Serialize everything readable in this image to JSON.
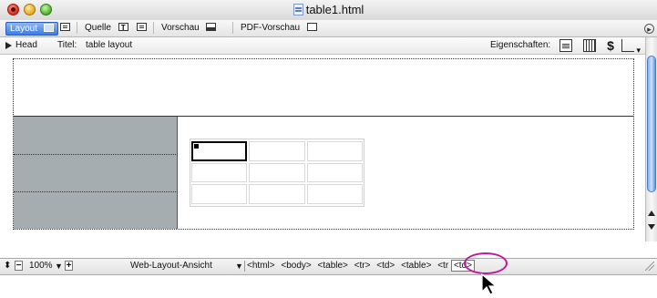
{
  "window": {
    "title": "table1.html",
    "title_icon": "html-document-icon"
  },
  "toolbar": {
    "layout_label": "Layout",
    "quelle_label": "Quelle",
    "vorschau_label": "Vorschau",
    "pdf_vorschau_label": "PDF-Vorschau"
  },
  "headbar": {
    "head_label": "Head",
    "titel_label": "Titel:",
    "titel_value": "table layout",
    "eigenschaften_label": "Eigenschaften:",
    "script_icon_glyph": "$"
  },
  "statusbar": {
    "zoom_minus": "−",
    "zoom_value": "100%",
    "zoom_plus": "+",
    "view_mode": "Web-Layout-Ansicht",
    "breadcrumb": [
      "<html>",
      "<body>",
      "<table>",
      "<tr>",
      "<td>",
      "<table>",
      "<tr"
    ],
    "selected_tag": "<td>"
  },
  "colors": {
    "accent": "#3f7be0",
    "highlight_ring": "#c2189b",
    "gray_cells": "#a6adb0"
  }
}
